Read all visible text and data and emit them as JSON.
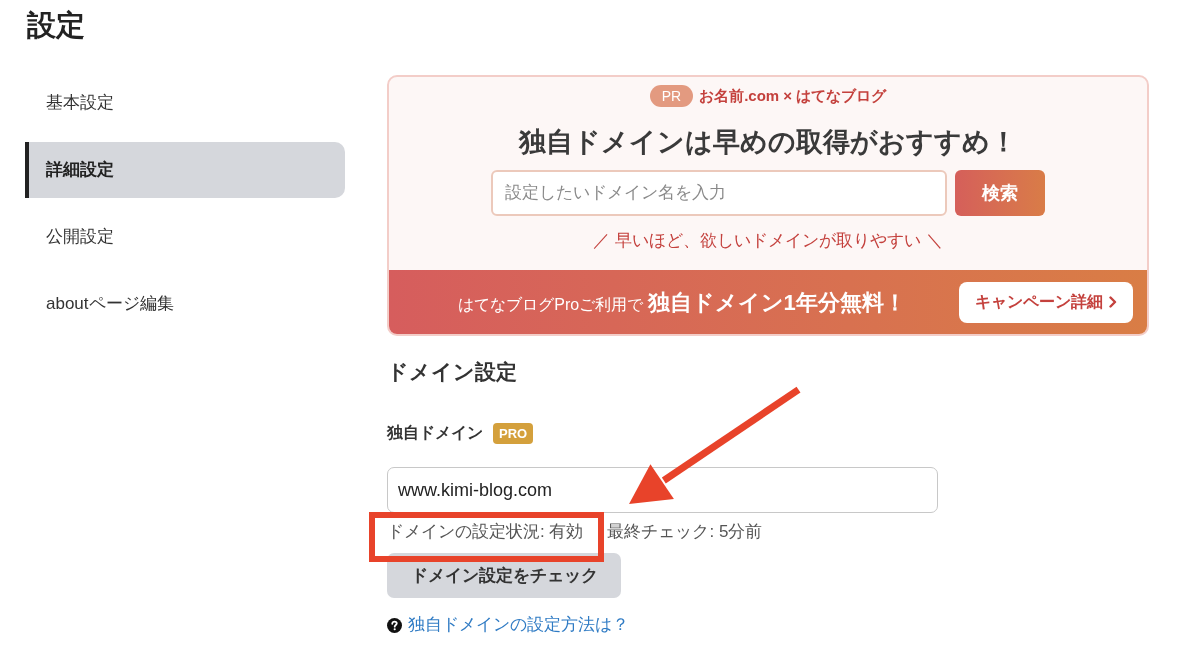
{
  "page": {
    "title": "設定"
  },
  "sidebar": {
    "items": [
      {
        "label": "基本設定",
        "selected": false
      },
      {
        "label": "詳細設定",
        "selected": true
      },
      {
        "label": "公開設定",
        "selected": false
      },
      {
        "label": "aboutページ編集",
        "selected": false
      }
    ]
  },
  "promo": {
    "badge": "PR",
    "sponsor": "お名前.com × はてなブログ",
    "headline": "独自ドメインは早めの取得がおすすめ！",
    "search": {
      "placeholder": "設定したいドメイン名を入力",
      "button": "検索"
    },
    "tagline": "／ 早いほど、欲しいドメインが取りやすい ＼",
    "banner": {
      "text": "はてなブログProご利用で **独自ドメイン1年分無料！**",
      "button": "キャンペーン詳細"
    }
  },
  "domain_settings": {
    "heading": "ドメイン設定",
    "field": {
      "label": "独自ドメイン",
      "badge": "PRO",
      "value": "www.kimi-blog.com"
    },
    "status": "ドメインの設定状況: 有効",
    "last_check": "最終チェック: 5分前",
    "check_button": "ドメイン設定をチェック",
    "help_link": "独自ドメインの設定方法は？"
  },
  "annotations": [
    {
      "kind": "arrow"
    },
    {
      "kind": "box"
    }
  ]
}
